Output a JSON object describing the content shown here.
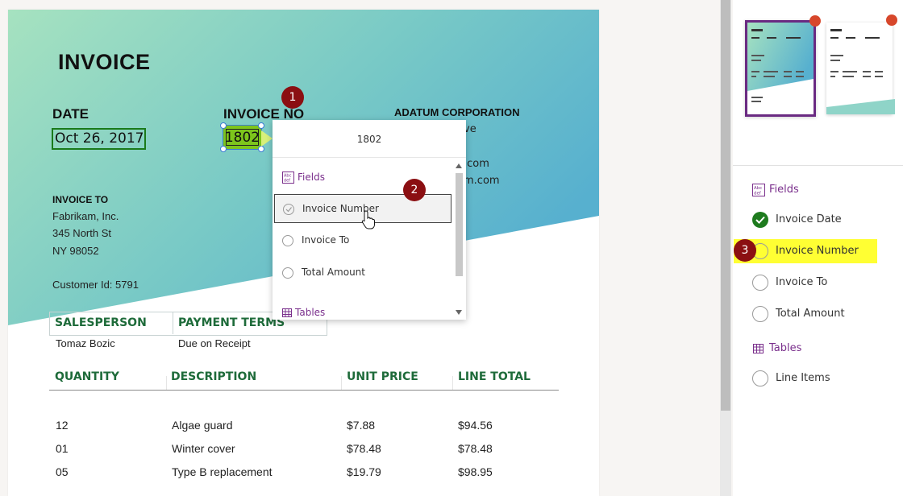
{
  "document": {
    "title": "INVOICE",
    "date_label": "DATE",
    "date_value": "Oct 26, 2017",
    "invoice_no_label": "INVOICE NO",
    "invoice_no_value": "1802",
    "company_name": "ADATUM CORPORATION",
    "company_fragments": [
      "ve",
      ".com",
      "m.com"
    ],
    "invoice_to_label": "INVOICE TO",
    "invoice_to_lines": [
      "Fabrikam, Inc.",
      "345 North St",
      "NY 98052"
    ],
    "customer_id": "Customer Id: 5791",
    "salesperson_label": "SALESPERSON",
    "payment_terms_label": "PAYMENT TERMS",
    "salesperson_value": "Tomaz Bozic",
    "payment_terms_value": "Due on Receipt",
    "columns": [
      "QUANTITY",
      "DESCRIPTION",
      "UNIT PRICE",
      "LINE TOTAL"
    ],
    "rows": [
      [
        "12",
        "Algae guard",
        "$7.88",
        "$94.56"
      ],
      [
        "01",
        "Winter cover",
        "$78.48",
        "$78.48"
      ],
      [
        "05",
        "Type B replacement",
        "$19.79",
        "$98.95"
      ]
    ]
  },
  "dropdown": {
    "search_value": "1802",
    "fields_label": "Fields",
    "items": [
      {
        "label": "Invoice Number",
        "selected": true
      },
      {
        "label": "Invoice To",
        "selected": false
      },
      {
        "label": "Total Amount",
        "selected": false
      }
    ],
    "tables_label": "Tables"
  },
  "markers": [
    "1",
    "2",
    "3"
  ],
  "panel": {
    "fields_label": "Fields",
    "fields": [
      {
        "label": "Invoice Date",
        "state": "checked"
      },
      {
        "label": "Invoice Number",
        "state": "highlighted"
      },
      {
        "label": "Invoice To",
        "state": "empty"
      },
      {
        "label": "Total Amount",
        "state": "empty"
      }
    ],
    "tables_label": "Tables",
    "tables": [
      {
        "label": "Line Items",
        "state": "empty"
      }
    ]
  },
  "colors": {
    "accent_purple": "#7a2f8c",
    "check_green": "#1e7b1e",
    "marker_red": "#8b0f12",
    "highlight_yellow": "#ffff33",
    "field_highlight_green": "#7dc51c",
    "table_header_green": "#1e6b3a"
  },
  "icons": [
    "abc-def-fields-icon",
    "table-grid-icon",
    "check-circle-icon",
    "radio-empty-icon",
    "hand-cursor-icon",
    "scroll-up-icon",
    "scroll-down-icon"
  ]
}
